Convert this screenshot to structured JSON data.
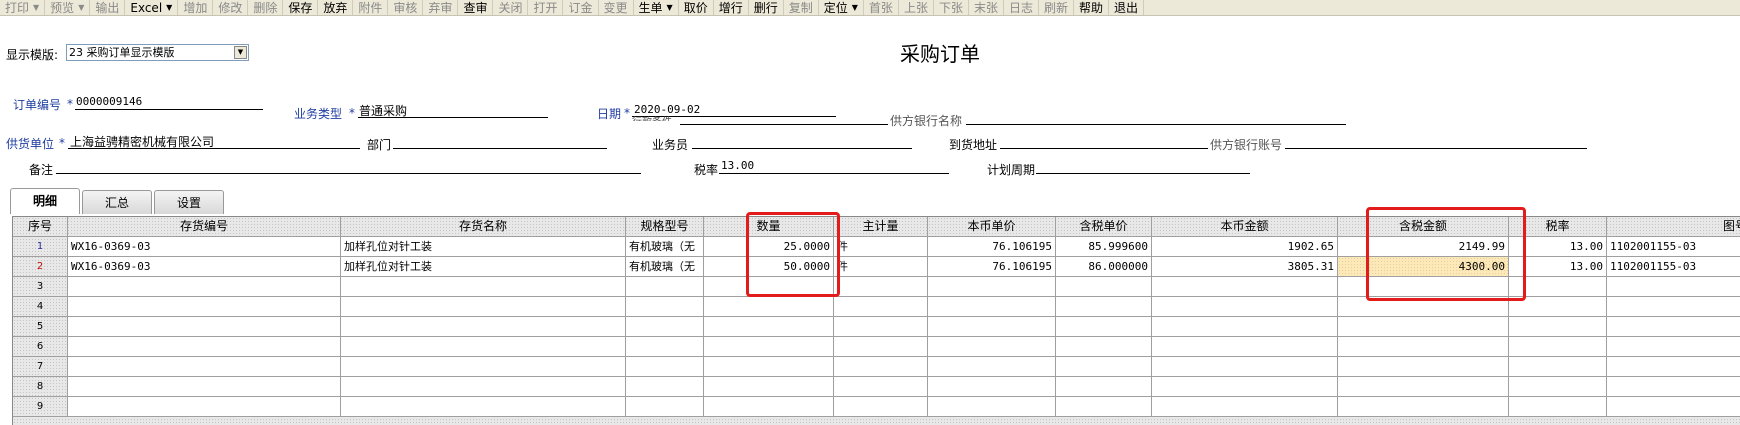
{
  "toolbar": {
    "items": [
      {
        "label": "打印",
        "dropdown": true,
        "enabled": false
      },
      {
        "label": "预览",
        "dropdown": true,
        "enabled": false
      },
      {
        "label": "输出",
        "dropdown": false,
        "enabled": false
      },
      {
        "label": "Excel",
        "dropdown": true,
        "enabled": true
      },
      {
        "label": "增加",
        "dropdown": false,
        "enabled": false
      },
      {
        "label": "修改",
        "dropdown": false,
        "enabled": false
      },
      {
        "label": "删除",
        "dropdown": false,
        "enabled": false
      },
      {
        "label": "保存",
        "dropdown": false,
        "enabled": true
      },
      {
        "label": "放弃",
        "dropdown": false,
        "enabled": true
      },
      {
        "label": "附件",
        "dropdown": false,
        "enabled": false
      },
      {
        "label": "审核",
        "dropdown": false,
        "enabled": false
      },
      {
        "label": "弃审",
        "dropdown": false,
        "enabled": false
      },
      {
        "label": "查审",
        "dropdown": false,
        "enabled": true
      },
      {
        "label": "关闭",
        "dropdown": false,
        "enabled": false
      },
      {
        "label": "打开",
        "dropdown": false,
        "enabled": false
      },
      {
        "label": "订金",
        "dropdown": false,
        "enabled": false
      },
      {
        "label": "变更",
        "dropdown": false,
        "enabled": false
      },
      {
        "label": "生单",
        "dropdown": true,
        "enabled": true
      },
      {
        "label": "取价",
        "dropdown": false,
        "enabled": true
      },
      {
        "label": "增行",
        "dropdown": false,
        "enabled": true
      },
      {
        "label": "删行",
        "dropdown": false,
        "enabled": true
      },
      {
        "label": "复制",
        "dropdown": false,
        "enabled": false
      },
      {
        "label": "定位",
        "dropdown": true,
        "enabled": true
      },
      {
        "label": "首张",
        "dropdown": false,
        "enabled": false
      },
      {
        "label": "上张",
        "dropdown": false,
        "enabled": false
      },
      {
        "label": "下张",
        "dropdown": false,
        "enabled": false
      },
      {
        "label": "末张",
        "dropdown": false,
        "enabled": false
      },
      {
        "label": "日志",
        "dropdown": false,
        "enabled": false
      },
      {
        "label": "刷新",
        "dropdown": false,
        "enabled": false
      },
      {
        "label": "帮助",
        "dropdown": false,
        "enabled": true
      },
      {
        "label": "退出",
        "dropdown": false,
        "enabled": true
      }
    ]
  },
  "template": {
    "label": "显示模版:",
    "value": "23 采购订单显示模版"
  },
  "page_title": "采购订单",
  "header": {
    "order_no_label": "订单编号",
    "order_no": "0000009146",
    "biz_type_label": "业务类型",
    "biz_type": "普通采购",
    "date_label": "日期",
    "date": "2020-09-02",
    "date_overlap": "行款条件",
    "bank_name_label": "供方银行名称",
    "supplier_label": "供货单位",
    "supplier": "上海益骋精密机械有限公司",
    "dept_label": "部门",
    "salesman_label": "业务员",
    "address_label": "到货地址",
    "bank_account_label": "供方银行账号",
    "remark_label": "备注",
    "tax_rate_label": "税率",
    "tax_rate": "13.00",
    "plan_period_label": "计划周期",
    "required_mark": "*"
  },
  "tabs": [
    "明细",
    "汇总",
    "设置"
  ],
  "table": {
    "columns": [
      "序号",
      "存货编号",
      "存货名称",
      "规格型号",
      "数量",
      "主计量",
      "本币单价",
      "含税单价",
      "本币金额",
      "含税金额",
      "税率",
      "图号"
    ],
    "rows": [
      {
        "no": "1",
        "code": "WX16-0369-03",
        "name": "加样孔位对针工装",
        "spec": "有机玻璃（无",
        "qty": "25.0000",
        "unit": "件",
        "price": "76.106195",
        "tax_price": "85.999600",
        "amount": "1902.65",
        "tax_amount": "2149.99",
        "tax_rate": "13.00",
        "drawing": "1102001155-03"
      },
      {
        "no": "2",
        "code": "WX16-0369-03",
        "name": "加样孔位对针工装",
        "spec": "有机玻璃（无",
        "qty": "50.0000",
        "unit": "件",
        "price": "76.106195",
        "tax_price": "86.000000",
        "amount": "3805.31",
        "tax_amount": "4300.00",
        "tax_rate": "13.00",
        "drawing": "1102001155-03"
      }
    ],
    "empty_row_numbers": [
      "3",
      "4",
      "5",
      "6",
      "7",
      "8",
      "9"
    ]
  }
}
